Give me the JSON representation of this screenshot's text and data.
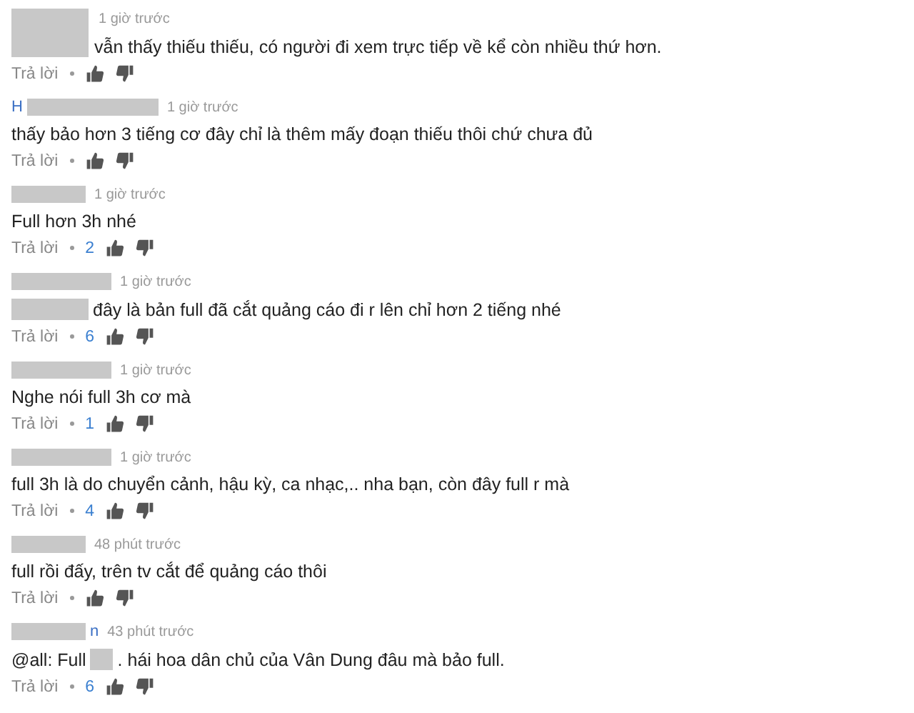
{
  "comments": [
    {
      "kind": "tall",
      "time": "1 giờ trước",
      "body": [
        {
          "kind": "text",
          "text": "vẫn thấy thiếu thiếu, có người đi xem trực tiếp về kể còn nhiều thứ hơn."
        }
      ],
      "reply": "Trả lời"
    },
    {
      "kind": "long",
      "name_fragment": "H",
      "time": "1 giờ trước",
      "body": [
        {
          "kind": "text",
          "text": "thấy bảo hơn 3 tiếng cơ đây chỉ là thêm mấy đoạn thiếu thôi chứ chưa đủ"
        }
      ],
      "reply": "Trả lời"
    },
    {
      "kind": "short",
      "time": "1 giờ trước",
      "body": [
        {
          "kind": "text",
          "text": "Full hơn 3h nhé"
        }
      ],
      "reply": "Trả lời",
      "likes": "2"
    },
    {
      "kind": "medium",
      "time": "1 giờ trước",
      "body": [
        {
          "kind": "redacted"
        },
        {
          "kind": "text",
          "text": "đây là bản full đã cắt quảng cáo đi r lên chỉ hơn 2 tiếng nhé"
        }
      ],
      "reply": "Trả lời",
      "likes": "6"
    },
    {
      "kind": "medium",
      "time": "1 giờ trước",
      "body": [
        {
          "kind": "text",
          "text": "Nghe nói full 3h cơ mà"
        }
      ],
      "reply": "Trả lời",
      "likes": "1"
    },
    {
      "kind": "medium",
      "time": "1 giờ trước",
      "body": [
        {
          "kind": "text",
          "text": "full 3h là do chuyển cảnh, hậu kỳ, ca nhạc,.. nha bạn, còn đây full r mà"
        }
      ],
      "reply": "Trả lời",
      "likes": "4"
    },
    {
      "kind": "short",
      "time": "48 phút trước",
      "body": [
        {
          "kind": "text",
          "text": "full rồi đấy, trên tv cắt để quảng cáo thôi"
        }
      ],
      "reply": "Trả lời"
    },
    {
      "kind": "short",
      "name_fragment_after": "n",
      "time": "43 phút trước",
      "body": [
        {
          "kind": "text",
          "text": "@all: Full"
        },
        {
          "kind": "redacted"
        },
        {
          "kind": "text",
          "text": ". hái hoa dân chủ của Vân Dung đâu mà bảo full."
        }
      ],
      "reply": "Trả lời",
      "likes": "6"
    }
  ]
}
